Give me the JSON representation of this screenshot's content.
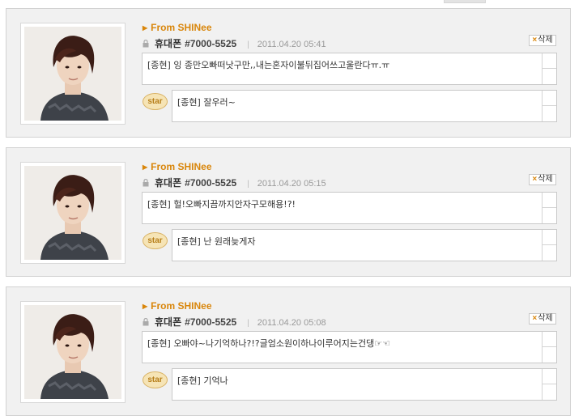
{
  "sender_name": "휴대폰",
  "delete_label": "삭제",
  "star_label": "star",
  "posts": [
    {
      "from": "From SHINee",
      "number": "#7000-5525",
      "date": "2011.04.20 05:41",
      "message": "[종현] 잉 종만오빠떠낫구만,,내는혼자이불뒤집어쓰고울란다ㅠ.ㅠ",
      "reply": "[종현] 잘우러~"
    },
    {
      "from": "From SHINee",
      "number": "#7000-5525",
      "date": "2011.04.20 05:15",
      "message": "[종현] 헐!오빠지끔까지안자구모해용!?!",
      "reply": "[종현] 난 원래늦게자"
    },
    {
      "from": "From SHINee",
      "number": "#7000-5525",
      "date": "2011.04.20 05:08",
      "message": "[종현] 오빠야~나기억하나?!?글엄소원이하나이루어지는건댕☞☜",
      "reply": "[종현] 기억나"
    }
  ]
}
